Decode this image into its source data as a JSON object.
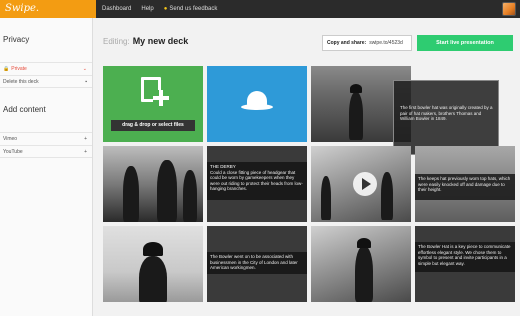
{
  "app": {
    "brand": "Swipe.",
    "nav": [
      "Dashboard",
      "Help",
      "Send us feedback"
    ],
    "feedback_icon": "bulb-icon"
  },
  "sidebar": {
    "privacy_heading": "Privacy",
    "privacy_items": [
      {
        "label": "Private",
        "icon": "lock-icon",
        "action_icon": "chevron-down-icon",
        "active": true
      },
      {
        "label": "Delete this deck",
        "icon": "",
        "action_icon": "trash-icon",
        "active": false
      }
    ],
    "content_heading": "Add content",
    "content_items": [
      {
        "label": "Vimeo",
        "action": "+"
      },
      {
        "label": "YouTube",
        "action": "+"
      }
    ]
  },
  "header": {
    "editing_label": "Editing:",
    "deck_title": "My new deck",
    "share_label": "Copy and share:",
    "share_url": "swipe.to/4523d",
    "start_button": "Start live presentation"
  },
  "upload": {
    "label": "drag & drop or select files"
  },
  "tiles": {
    "popup_text": "The first bowler hat was originally created by a pair of hat makers, brothers Thomas and William Bowler in 1849.",
    "derby_title": "THE DERBY",
    "derby_text": "Could a close fitting piece of headgear that could be worn by gamekeepers when they were out riding to protect their heads from low-hanging branches.",
    "keeps_text": "The keeps hat previously worn top hats, which were easily knocked off and damage due to their height.",
    "bowler_text": "The Bowler went on to be associated with businessmen in the City of London and later American workingmen.",
    "symbol_text": "The Bowler Hat is a key piece to communicate effortless elegant style. We chose them to symbol to present and invite participants in a simple but elegant way."
  },
  "colors": {
    "brand": "#f39c12",
    "upload_tile": "#4caf50",
    "hat_tile": "#2e9ad8",
    "start_button": "#2ecc71",
    "private_accent": "#e74c3c"
  }
}
